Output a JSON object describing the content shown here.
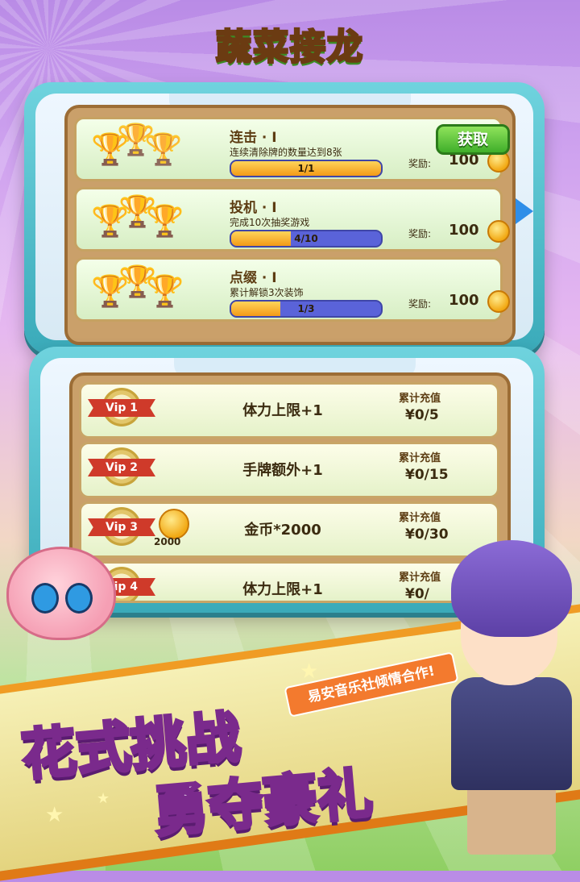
{
  "game": {
    "logo": "蔬菜接龙"
  },
  "achievements": [
    {
      "title": "连击 · I",
      "desc": "连续清除牌的数量达到8张",
      "progress_text": "1/1",
      "progress": 1.0,
      "reward_label": "奖励:",
      "reward": "100",
      "button": "获取",
      "trophy_count": 1
    },
    {
      "title": "投机 · I",
      "desc": "完成10次抽奖游戏",
      "progress_text": "4/10",
      "progress": 0.4,
      "reward_label": "奖励:",
      "reward": "100"
    },
    {
      "title": "点缀 · I",
      "desc": "累计解锁3次装饰",
      "progress_text": "1/3",
      "progress": 0.33,
      "reward_label": "奖励:",
      "reward": "100"
    }
  ],
  "vip": [
    {
      "badge": "Vip 1",
      "perk": "体力上限+1",
      "cum_label": "累计充值",
      "progress": "¥0/5"
    },
    {
      "badge": "Vip 2",
      "perk": "手牌额外+1",
      "cum_label": "累计充值",
      "progress": "¥0/15"
    },
    {
      "badge": "Vip 3",
      "perk": "金币*2000",
      "cum_label": "累计充值",
      "progress": "¥0/30",
      "coin_label": "2000"
    },
    {
      "badge": "Vip 4",
      "perk": "体力上限+1",
      "cum_label": "累计充值",
      "progress": "¥0/"
    }
  ],
  "banner": {
    "slogan_line1": "花式挑战",
    "slogan_line2": "勇夺豪礼",
    "coop_tag": "易安音乐社倾情合作!"
  },
  "colors": {
    "accent_green": "#3fae2a",
    "progress_blue": "#5a63d9",
    "progress_orange": "#f39a16",
    "slogan_purple": "#7a2a8c"
  }
}
